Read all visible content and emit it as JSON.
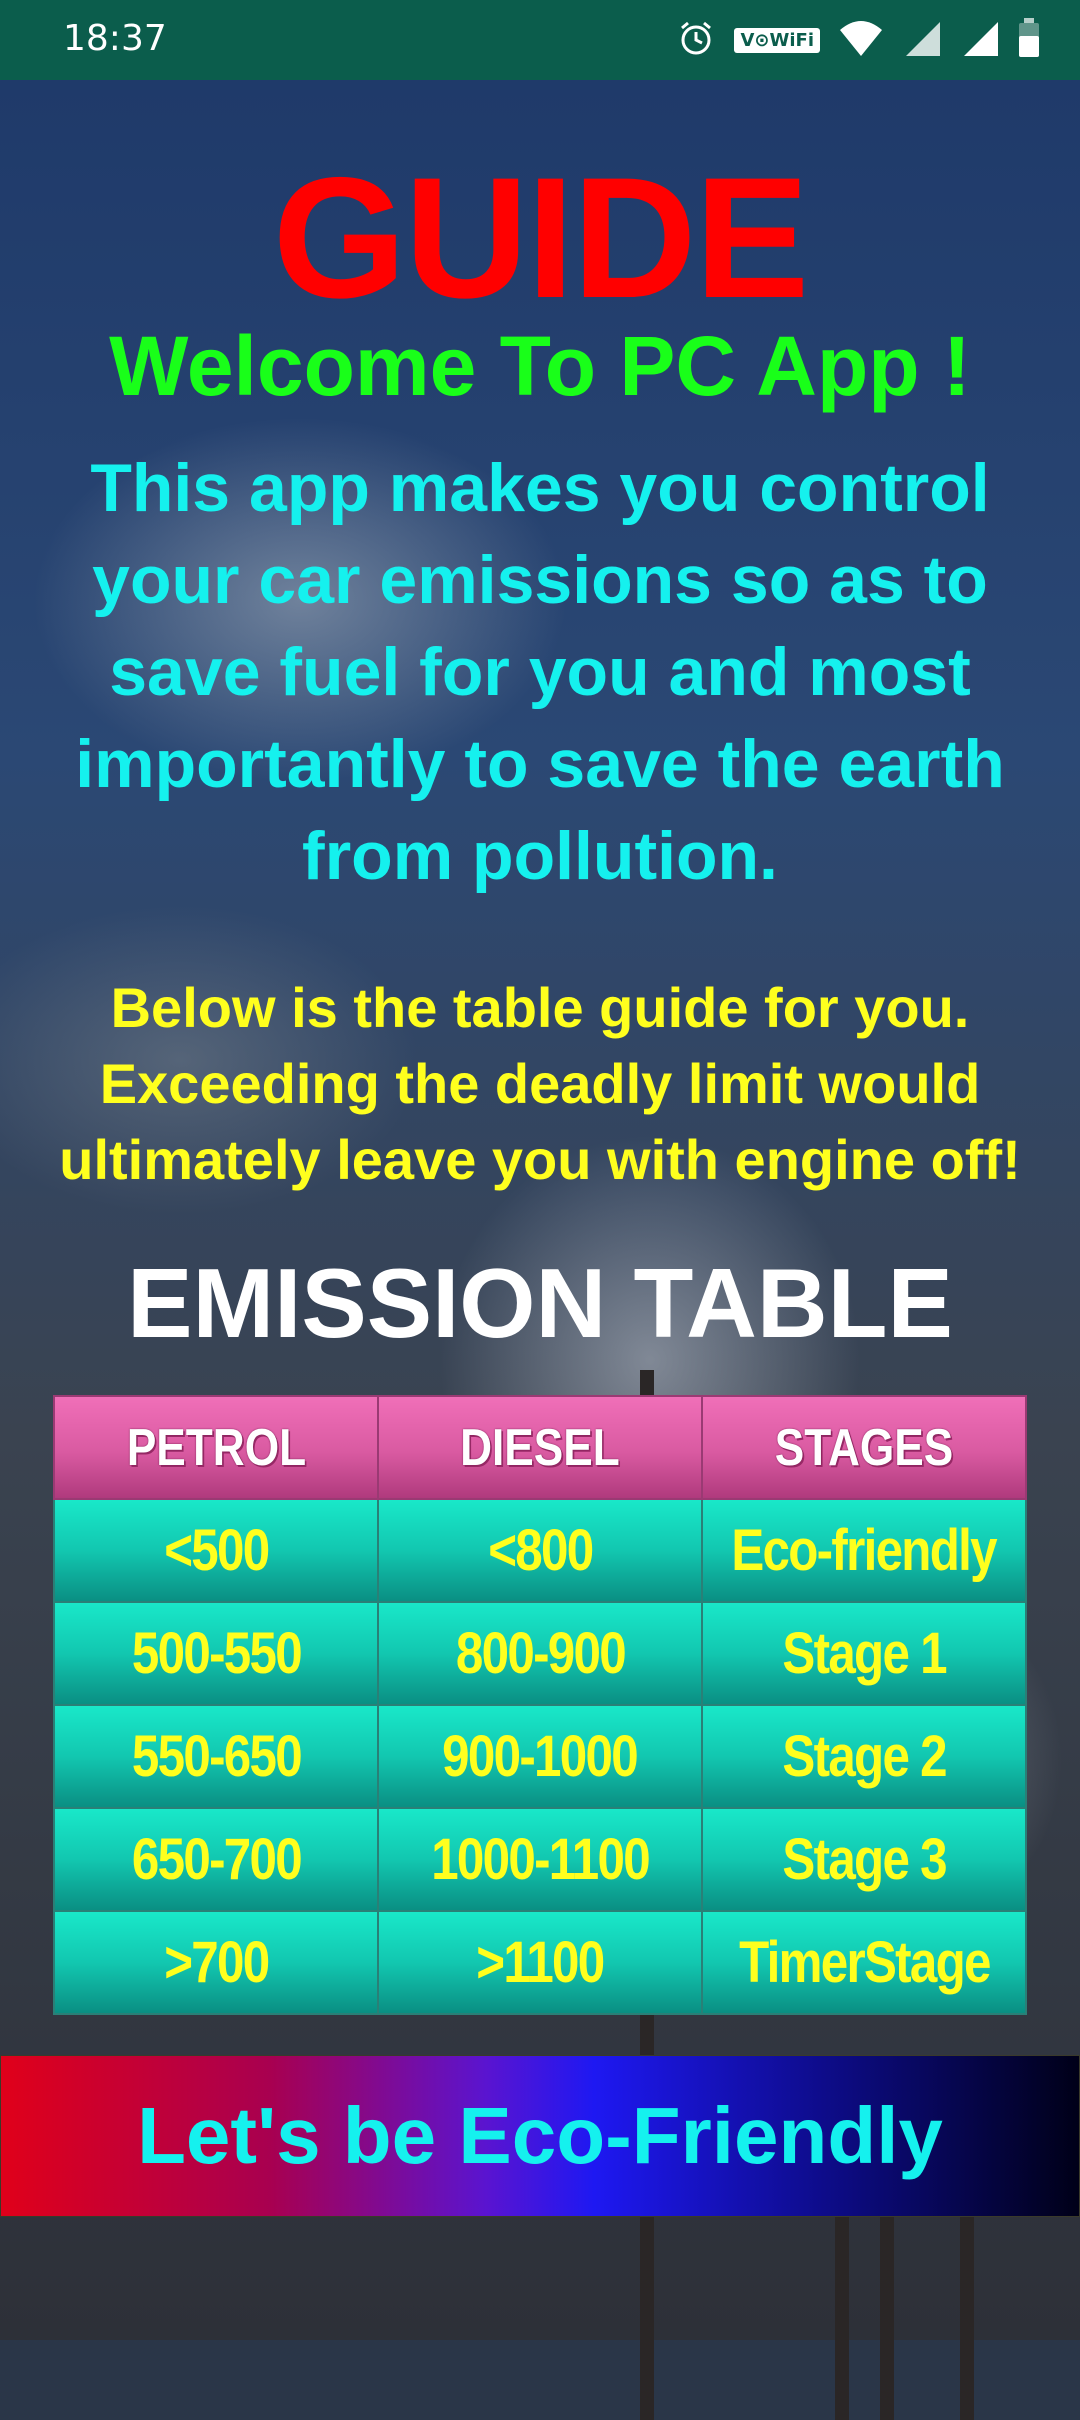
{
  "status_bar": {
    "time": "18:37",
    "wifi_badge": "V⊙WiFi",
    "icons": [
      "alarm-icon",
      "wifi-icon",
      "signal-icon",
      "signal-icon",
      "battery-icon"
    ]
  },
  "page": {
    "title": "GUIDE",
    "welcome": "Welcome To PC App !",
    "intro_lines": [
      "This app makes you control",
      "your car emissions so as to",
      "save fuel for you and most",
      "importantly to save the earth",
      "from pollution."
    ],
    "notice_lines": [
      "Below is the table guide for you.",
      "Exceeding the deadly limit would",
      "ultimately leave you with engine off!"
    ],
    "table_heading": "EMISSION TABLE"
  },
  "emission_table": {
    "headers": [
      "PETROL",
      "DIESEL",
      "STAGES"
    ],
    "rows": [
      [
        "<500",
        "<800",
        "Eco-friendly"
      ],
      [
        "500-550",
        "800-900",
        "Stage 1"
      ],
      [
        "550-650",
        "900-1000",
        "Stage 2"
      ],
      [
        "650-700",
        "1000-1100",
        "Stage 3"
      ],
      [
        ">700",
        ">1100",
        "TimerStage"
      ]
    ]
  },
  "banner": {
    "label": "Let's be Eco-Friendly"
  },
  "colors": {
    "status_bar": "#0b5d4c",
    "title": "#ff0000",
    "welcome": "#19ff19",
    "intro": "#15f1ee",
    "notice": "#ffff1e",
    "table_header": "#d95aa1",
    "table_cell": "#12c7b0"
  }
}
